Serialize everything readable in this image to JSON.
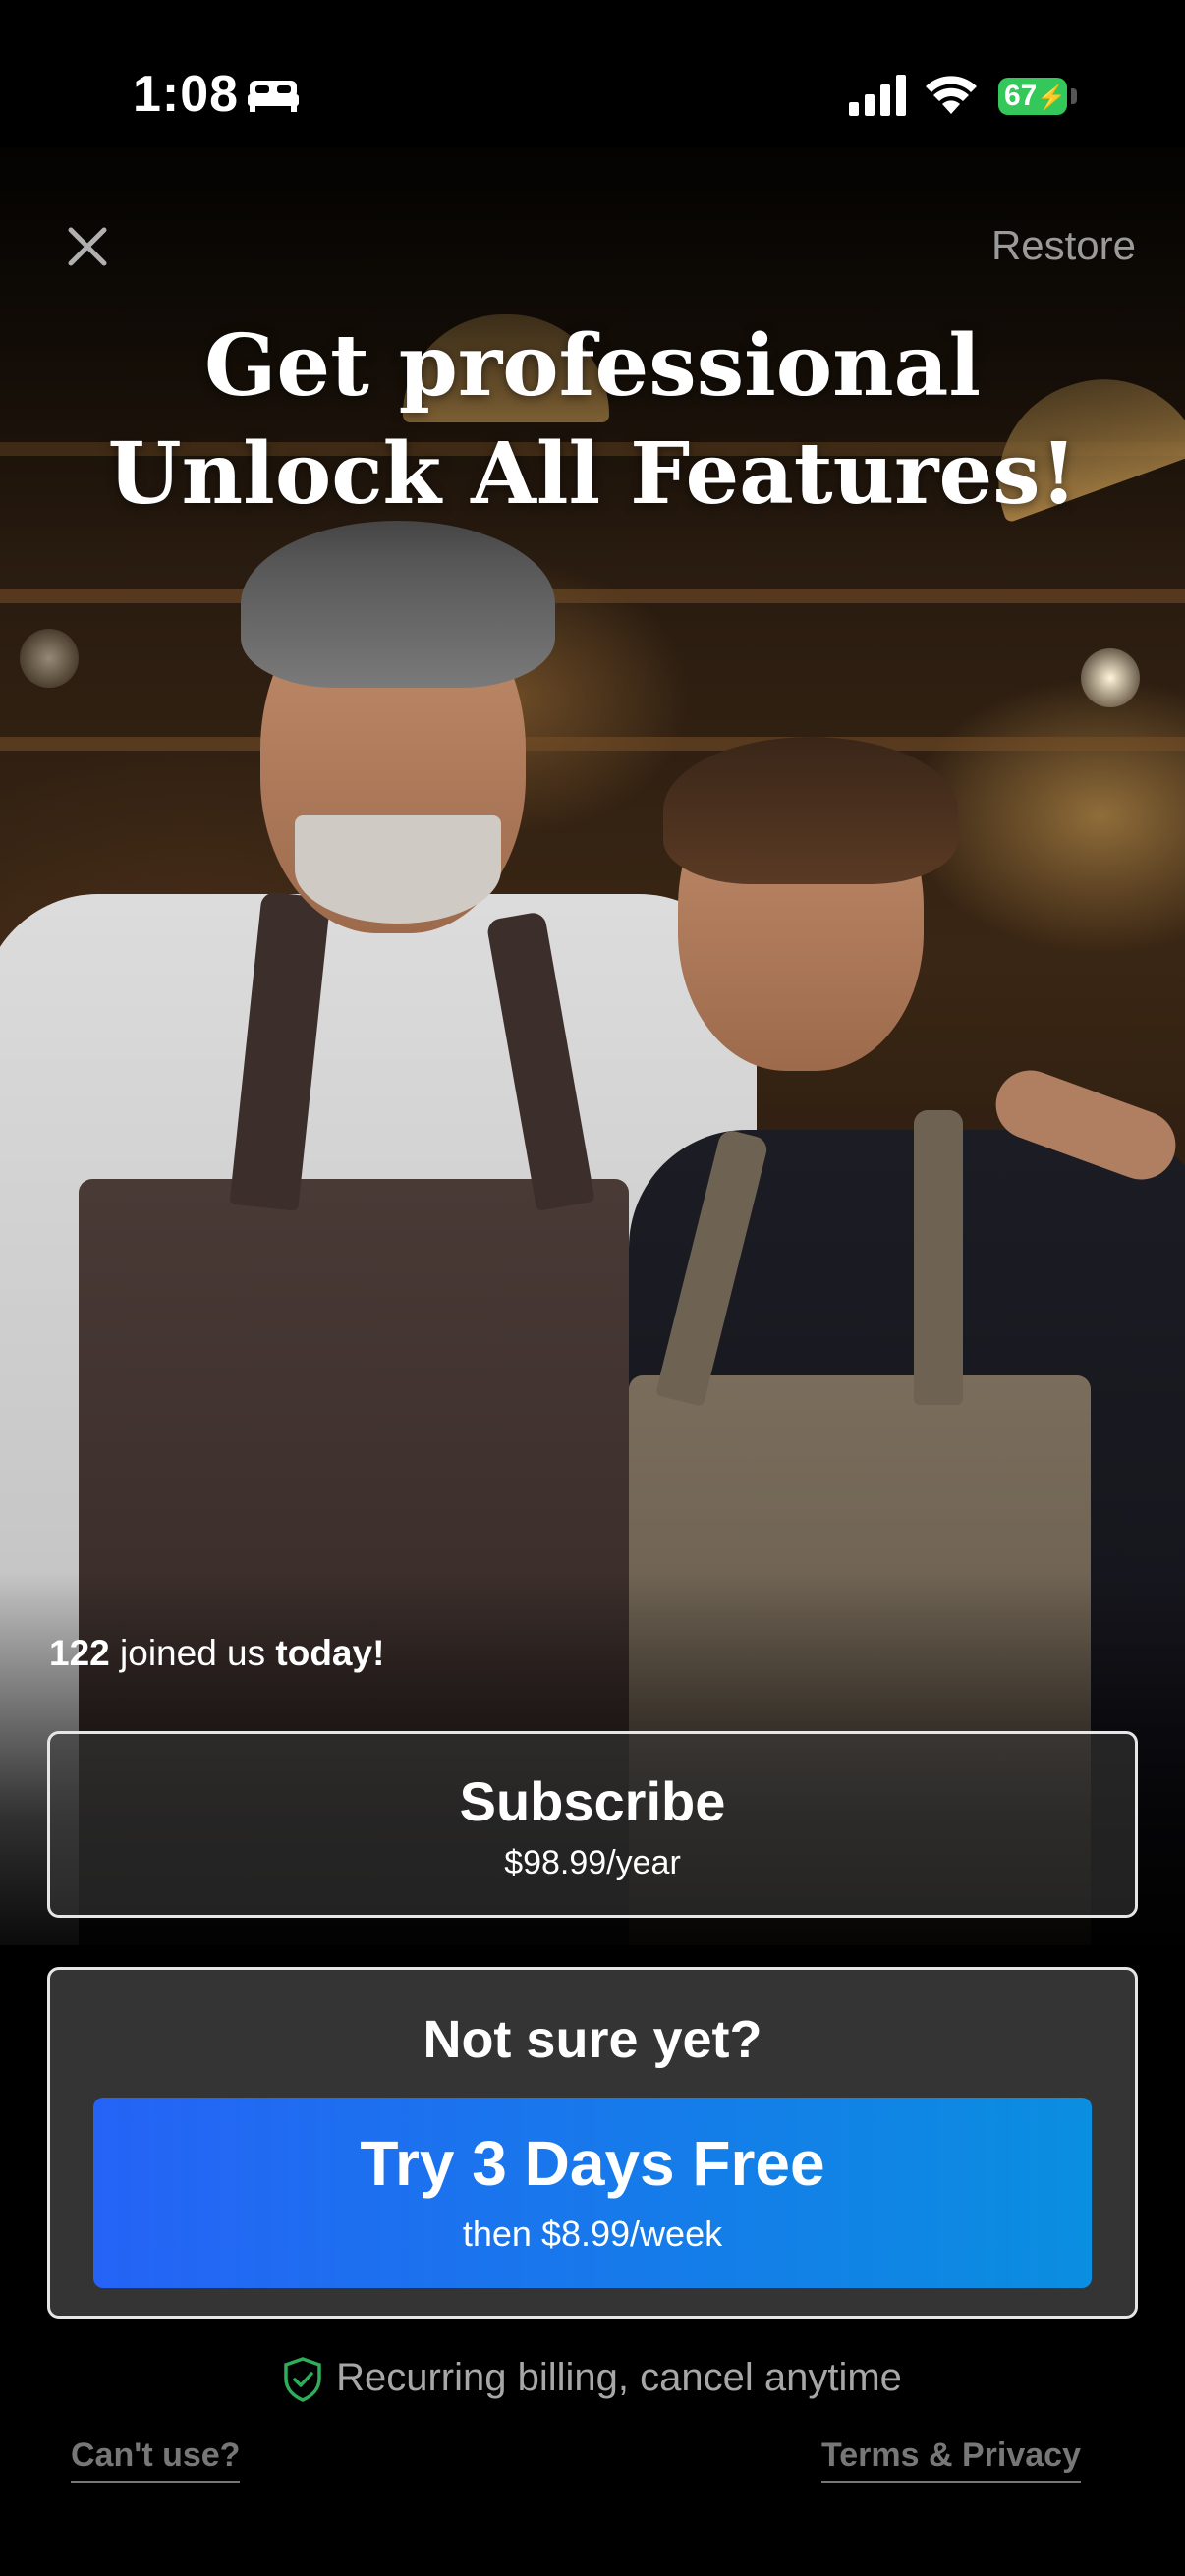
{
  "status_bar": {
    "time": "1:08",
    "battery": "67"
  },
  "top_bar": {
    "close_icon": "close-icon",
    "restore_label": "Restore"
  },
  "headline": {
    "line1": "Get professional",
    "line2": "Unlock All Features!"
  },
  "social_proof": {
    "count": "122",
    "middle": "joined us",
    "end": "today!"
  },
  "subscribe": {
    "label": "Subscribe",
    "price": "$98.99/year"
  },
  "trial": {
    "heading": "Not sure yet?",
    "button_label": "Try 3 Days Free",
    "button_sub": "then $8.99/week"
  },
  "billing_note": "Recurring billing, cancel anytime",
  "footer": {
    "left_link": "Can't use?",
    "right_link": "Terms & Privacy"
  },
  "colors": {
    "accent_start": "#2563f6",
    "accent_end": "#0a8ee0",
    "battery": "#34c759",
    "shield": "#2fae5a"
  }
}
